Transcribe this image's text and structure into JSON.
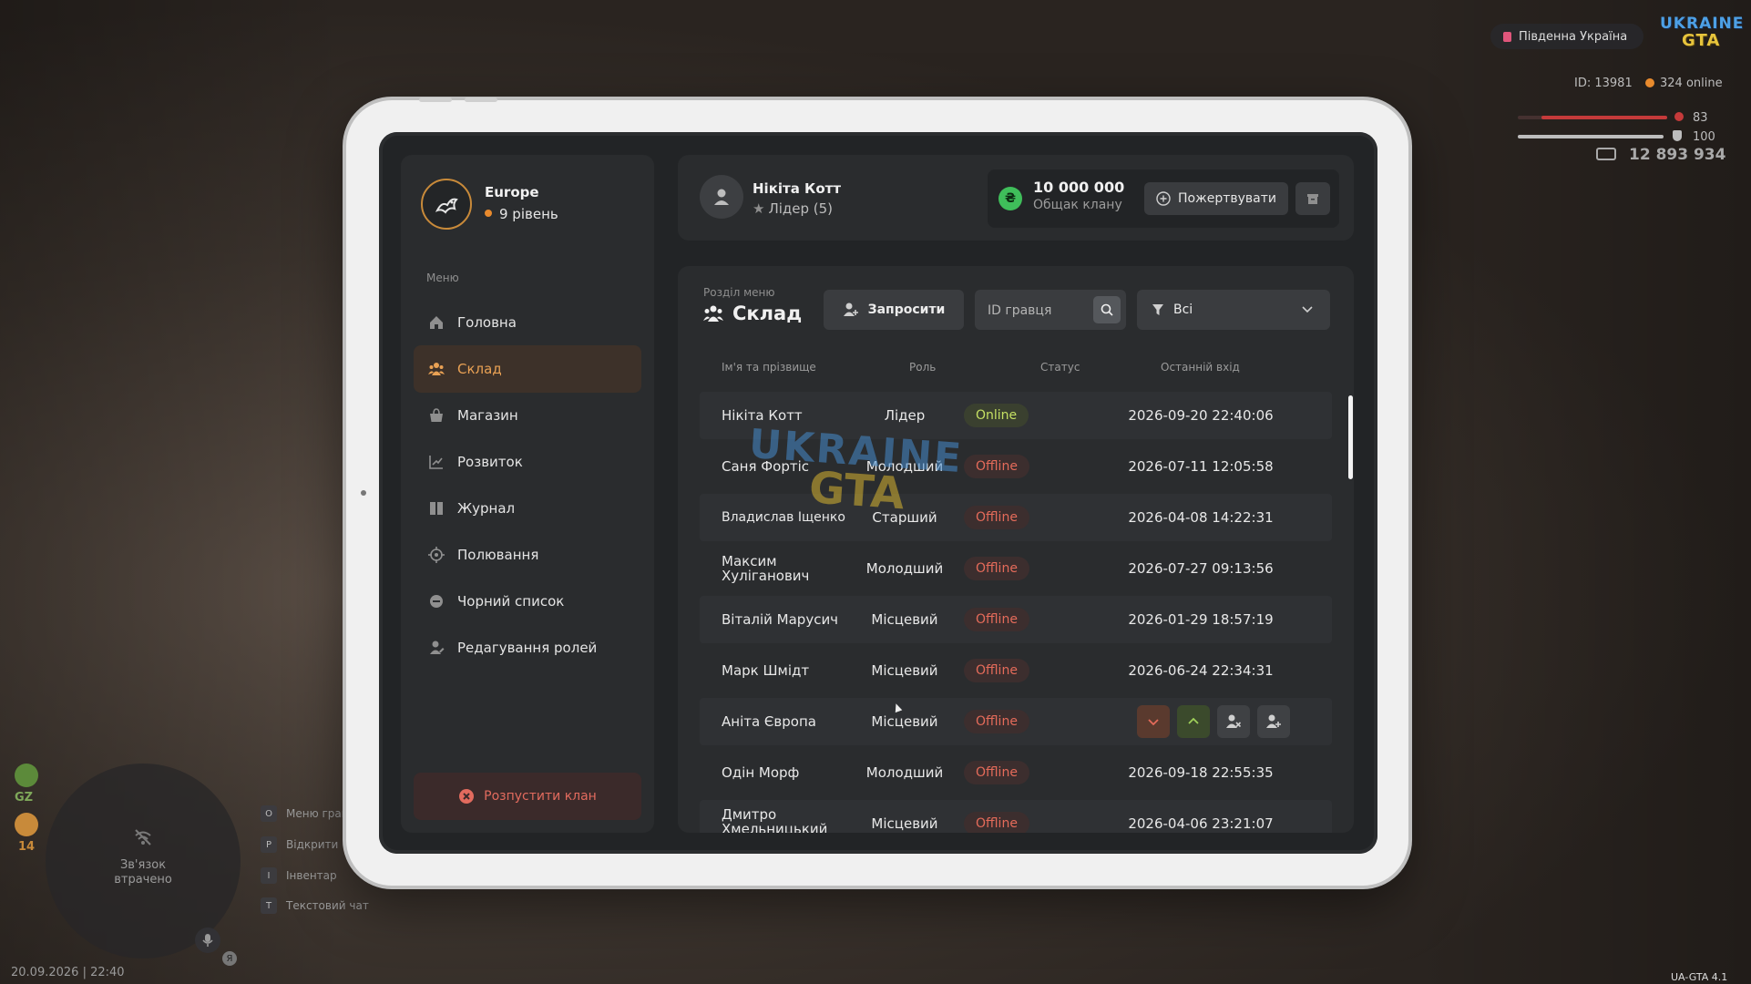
{
  "hud": {
    "server_name": "Південна Україна",
    "logo_line1": "UKRAINE",
    "logo_line2": "GTA",
    "player_id": "ID: 13981",
    "online": "324 online",
    "health": "83",
    "armor": "100",
    "money": "12 893 934",
    "radar_status": "Зв'язок втрачено",
    "gz_label": "GZ",
    "level_num": "14",
    "hints": [
      {
        "key": "O",
        "label": "Меню гравця"
      },
      {
        "key": "P",
        "label": "Відкрити"
      },
      {
        "key": "I",
        "label": "Інвентар"
      },
      {
        "key": "T",
        "label": "Текстовий чат"
      }
    ],
    "mic_badge": "Я",
    "datetime": "20.09.2026 | 22:40",
    "version": "UA-GTA 4.1"
  },
  "sidebar": {
    "clan_name": "Europe",
    "clan_level": "9 рівень",
    "menu_caption": "Меню",
    "items": [
      {
        "label": "Головна",
        "icon": "home-icon"
      },
      {
        "label": "Склад",
        "icon": "group-icon",
        "active": true
      },
      {
        "label": "Магазин",
        "icon": "shop-icon"
      },
      {
        "label": "Розвиток",
        "icon": "chart-icon"
      },
      {
        "label": "Журнал",
        "icon": "book-icon"
      },
      {
        "label": "Полювання",
        "icon": "target-icon"
      },
      {
        "label": "Чорний список",
        "icon": "block-icon"
      },
      {
        "label": "Редагування ролей",
        "icon": "user-edit-icon"
      }
    ],
    "disband_label": "Розпустити клан"
  },
  "profile": {
    "name": "Нікіта Котт",
    "role": "Лідер (5)",
    "bank_amount": "10 000 000",
    "bank_label": "Общак клану",
    "coin_symbol": "₴",
    "donate_label": "Пожертвувати"
  },
  "members": {
    "section_caption": "Розділ меню",
    "section_title": "Склад",
    "invite_label": "Запросити",
    "search_placeholder": "ID гравця",
    "filter_value": "Всі",
    "columns": [
      "Ім'я та прізвище",
      "Роль",
      "Статус",
      "Останній вхід"
    ],
    "rows": [
      {
        "name": "Нікіта Котт",
        "role": "Лідер",
        "status": "Online",
        "last": "2026-09-20 22:40:06"
      },
      {
        "name": "Саня Фортіс",
        "role": "Молодший",
        "status": "Offline",
        "last": "2026-07-11 12:05:58"
      },
      {
        "name": "Владислав Іщенко",
        "role": "Старший",
        "status": "Offline",
        "last": "2026-04-08 14:22:31"
      },
      {
        "name": "Максим Хуліганович",
        "role": "Молодший",
        "status": "Offline",
        "last": "2026-07-27 09:13:56"
      },
      {
        "name": "Віталій Марусич",
        "role": "Місцевий",
        "status": "Offline",
        "last": "2026-01-29 18:57:19"
      },
      {
        "name": "Марк Шмідт",
        "role": "Місцевий",
        "status": "Offline",
        "last": "2026-06-24 22:34:31"
      },
      {
        "name": "Аніта Європа",
        "role": "Місцевий",
        "status": "Offline",
        "last": ""
      },
      {
        "name": "Одін Морф",
        "role": "Молодший",
        "status": "Offline",
        "last": "2026-09-18 22:55:35"
      },
      {
        "name": "Дмитро Хмельницький",
        "role": "Місцевий",
        "status": "Offline",
        "last": "2026-04-06 23:21:07"
      }
    ]
  },
  "colors": {
    "accent": "#e88a2d",
    "online": "#c5e063",
    "offline": "#e46b5a",
    "panel": "#2a2c2e",
    "screen": "#222426"
  }
}
